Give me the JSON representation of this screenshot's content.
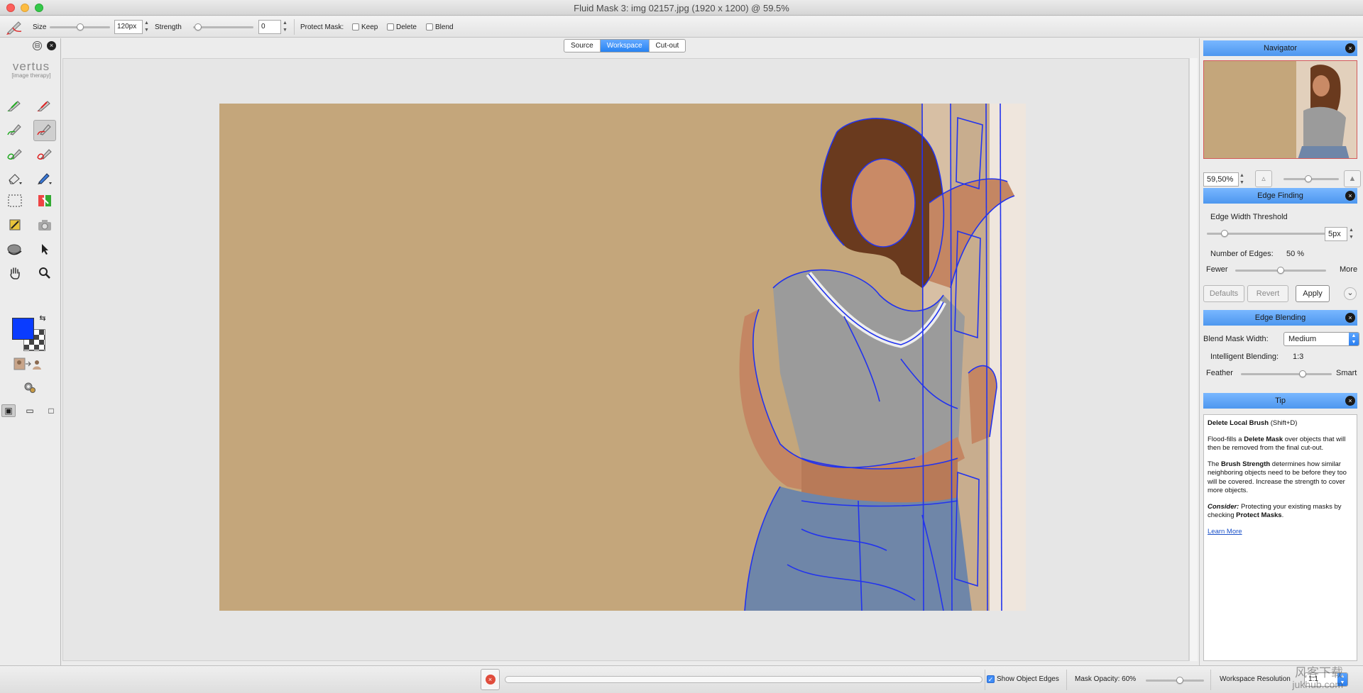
{
  "window": {
    "title": "Fluid Mask 3: img 02157.jpg (1920 x 1200) @ 59.5%"
  },
  "toolbar": {
    "size_label": "Size",
    "size_value": "120px",
    "strength_label": "Strength",
    "strength_value": "0",
    "protect_label": "Protect Mask:",
    "keep_label": "Keep",
    "delete_label": "Delete",
    "blend_label": "Blend"
  },
  "logo": {
    "name": "vertus",
    "tagline": "[image therapy]"
  },
  "tools": [
    "green-brush",
    "red-brush",
    "green-local-brush",
    "red-local-brush",
    "green-patch-brush",
    "red-patch-brush",
    "eraser",
    "blue-pencil",
    "rect-select",
    "color-fill",
    "wand",
    "camera",
    "mask-blob",
    "pointer",
    "hand",
    "zoom"
  ],
  "tabs": [
    {
      "label": "Source",
      "active": false
    },
    {
      "label": "Workspace",
      "active": true
    },
    {
      "label": "Cut-out",
      "active": false
    }
  ],
  "status": {
    "show_edges_label": "Show Object Edges",
    "mask_opacity_label": "Mask Opacity: 60%",
    "mask_opacity_value": 0.6,
    "workspace_resolution_label": "Workspace Resolution",
    "workspace_resolution_value": "1:1"
  },
  "navigator": {
    "title": "Navigator",
    "zoom_value": "59,50%"
  },
  "edge_finding": {
    "title": "Edge Finding",
    "threshold_label": "Edge Width Threshold",
    "threshold_value": "5px",
    "edges_label": "Number of Edges:",
    "edges_value": "50 %",
    "fewer_label": "Fewer",
    "more_label": "More",
    "defaults_label": "Defaults",
    "revert_label": "Revert",
    "apply_label": "Apply"
  },
  "edge_blending": {
    "title": "Edge Blending",
    "mask_width_label": "Blend Mask Width:",
    "mask_width_value": "Medium",
    "intelligent_label": "Intelligent Blending:",
    "intelligent_value": "1:3",
    "feather_label": "Feather",
    "smart_label": "Smart"
  },
  "tip": {
    "title": "Tip",
    "heading": "Delete Local Brush",
    "shortcut": "(Shift+D)",
    "p1_a": "Flood-fills a ",
    "p1_b": "Delete Mask",
    "p1_c": " over objects that will then be removed from the final cut-out.",
    "p2_a": "The ",
    "p2_b": "Brush Strength",
    "p2_c": " determines how similar neighboring objects need to be before they too will be covered. Increase the strength to cover more objects.",
    "p3_a": "Consider:",
    "p3_b": " Protecting your existing masks by checking ",
    "p3_c": "Protect Masks",
    "p3_d": ".",
    "link": "Learn More"
  },
  "watermark": {
    "cn": "风客下载",
    "url": "jukhub.com"
  },
  "colors": {
    "foreground": "#0a3cff",
    "accent": "#4d97ef",
    "edge_lines": "#2233ee",
    "photo_bg": "#c4a67b"
  }
}
